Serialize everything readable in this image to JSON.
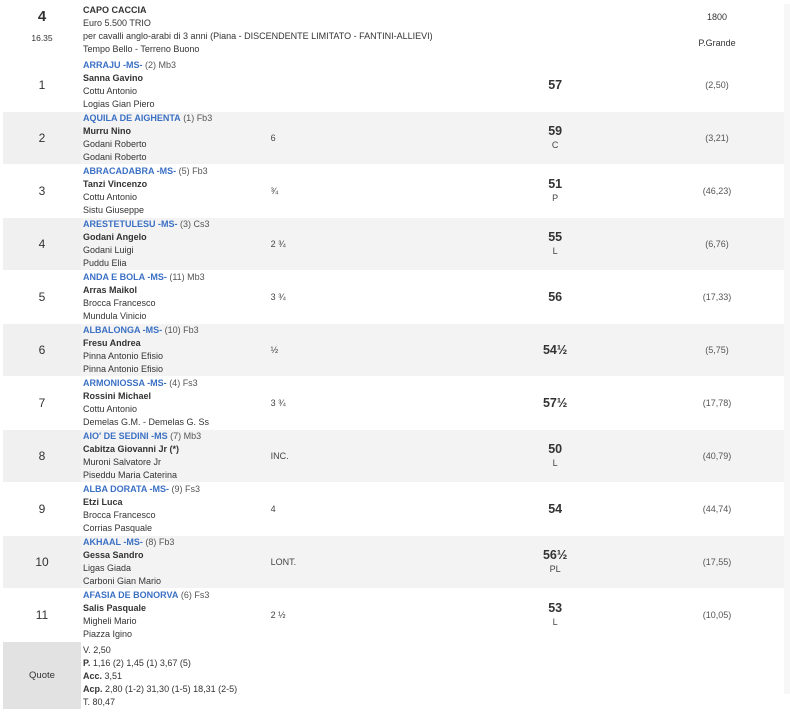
{
  "race": {
    "number": "4",
    "time": "16.35",
    "name": "CAPO CACCIA",
    "prize": "Euro 5.500 TRIO",
    "conditions": "per cavalli anglo-arabi di 3 anni (Piana -  DISCENDENTE LIMITATO  - FANTINI-ALLIEVI)",
    "weather": "Tempo Bello - Terreno Buono",
    "distance": "1800",
    "track": "P.Grande"
  },
  "runners": [
    {
      "pos": "1",
      "horse": "ARRAJU -MS-",
      "extra": "(2) Mb3",
      "jockey": "Sanna Gavino",
      "trainer": "Cottu Antonio",
      "owner": "Logias Gian Piero",
      "dist": "",
      "weight": "57",
      "note": "",
      "odds": "(2,50)"
    },
    {
      "pos": "2",
      "horse": "AQUILA DE AIGHENTA",
      "extra": "(1) Fb3",
      "jockey": "Murru Nino",
      "trainer": "Godani Roberto",
      "owner": "Godani Roberto",
      "dist": "6",
      "weight": "59",
      "note": "C",
      "odds": "(3,21)"
    },
    {
      "pos": "3",
      "horse": "ABRACADABRA -MS-",
      "extra": "(5) Fb3",
      "jockey": "Tanzi Vincenzo",
      "trainer": "Cottu Antonio",
      "owner": "Sistu Giuseppe",
      "dist": "¾",
      "weight": "51",
      "note": "P",
      "odds": "(46,23)"
    },
    {
      "pos": "4",
      "horse": "ARESTETULESU -MS-",
      "extra": "(3) Cs3",
      "jockey": "Godani Angelo",
      "trainer": "Godani Luigi",
      "owner": "Puddu Elia",
      "dist": "2 ¾",
      "weight": "55",
      "note": "L",
      "odds": "(6,76)"
    },
    {
      "pos": "5",
      "horse": "ANDA E BOLA -MS-",
      "extra": "(11) Mb3",
      "jockey": "Arras Maikol",
      "trainer": "Brocca Francesco",
      "owner": "Mundula Vinicio",
      "dist": "3 ¾",
      "weight": "56",
      "note": "",
      "odds": "(17,33)"
    },
    {
      "pos": "6",
      "horse": "ALBALONGA -MS-",
      "extra": "(10) Fb3",
      "jockey": "Fresu Andrea",
      "trainer": "Pinna Antonio Efisio",
      "owner": "Pinna Antonio Efisio",
      "dist": "½",
      "weight": "54½",
      "note": "",
      "odds": "(5,75)"
    },
    {
      "pos": "7",
      "horse": "ARMONIOSSA -MS-",
      "extra": "(4) Fs3",
      "jockey": "Rossini Michael",
      "trainer": "Cottu Antonio",
      "owner": "Demelas G.M. - Demelas G. Ss",
      "dist": "3 ¾",
      "weight": "57½",
      "note": "",
      "odds": "(17,78)"
    },
    {
      "pos": "8",
      "horse": "AIO' DE SEDINI -MS",
      "extra": "(7) Mb3",
      "jockey": "Cabitza Giovanni Jr (*)",
      "trainer": "Muroni Salvatore Jr",
      "owner": "Piseddu Maria Caterina",
      "dist": "INC.",
      "weight": "50",
      "note": "L",
      "odds": "(40,79)"
    },
    {
      "pos": "9",
      "horse": "ALBA DORATA -MS-",
      "extra": "(9) Fs3",
      "jockey": "Etzi Luca",
      "trainer": "Brocca Francesco",
      "owner": "Corrias Pasquale",
      "dist": "4",
      "weight": "54",
      "note": "",
      "odds": "(44,74)"
    },
    {
      "pos": "10",
      "horse": "AKHAAL -MS-",
      "extra": "(8) Fb3",
      "jockey": "Gessa Sandro",
      "trainer": "Ligas Giada",
      "owner": "Carboni Gian Mario",
      "dist": "LONT.",
      "weight": "56½",
      "note": "PL",
      "odds": "(17,55)"
    },
    {
      "pos": "11",
      "horse": "AFASIA DE BONORVA",
      "extra": "(6) Fs3",
      "jockey": "Salis Pasquale",
      "trainer": "Migheli Mario",
      "owner": "Piazza Igino",
      "dist": "2 ½",
      "weight": "53",
      "note": "L",
      "odds": "(10,05)"
    }
  ],
  "quote": {
    "label": "Quote",
    "lines": [
      {
        "k": "V.",
        "v": "2,50",
        "bold": false
      },
      {
        "k": "P.",
        "v": "1,16 (2)  1,45 (1)  3,67 (5)",
        "bold": true
      },
      {
        "k": "Acc.",
        "v": "3,51",
        "bold": true
      },
      {
        "k": "Acp.",
        "v": "2,80 (1-2)  31,30 (1-5)  18,31 (2-5)",
        "bold": true
      },
      {
        "k": "T.",
        "v": "80,47",
        "bold": false
      }
    ]
  }
}
